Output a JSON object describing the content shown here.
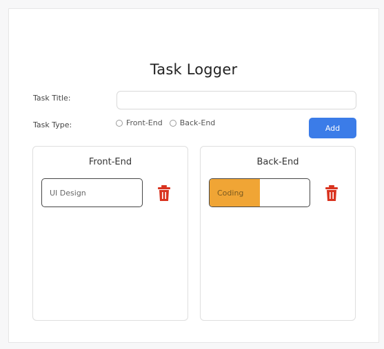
{
  "app": {
    "title": "Task Logger"
  },
  "form": {
    "title_label": "Task Title:",
    "title_value": "",
    "type_label": "Task Type:",
    "type_options": [
      "Front-End",
      "Back-End"
    ],
    "add_label": "Add"
  },
  "columns": [
    {
      "heading": "Front-End",
      "tasks": [
        {
          "text": "UI Design",
          "progress": 0
        }
      ]
    },
    {
      "heading": "Back-End",
      "tasks": [
        {
          "text": "Coding",
          "progress": 0.5
        }
      ]
    }
  ],
  "colors": {
    "accent": "#3b7ce8",
    "progress": "#f0a535",
    "delete": "#d9331f"
  },
  "icons": {
    "delete": "trash-icon"
  }
}
